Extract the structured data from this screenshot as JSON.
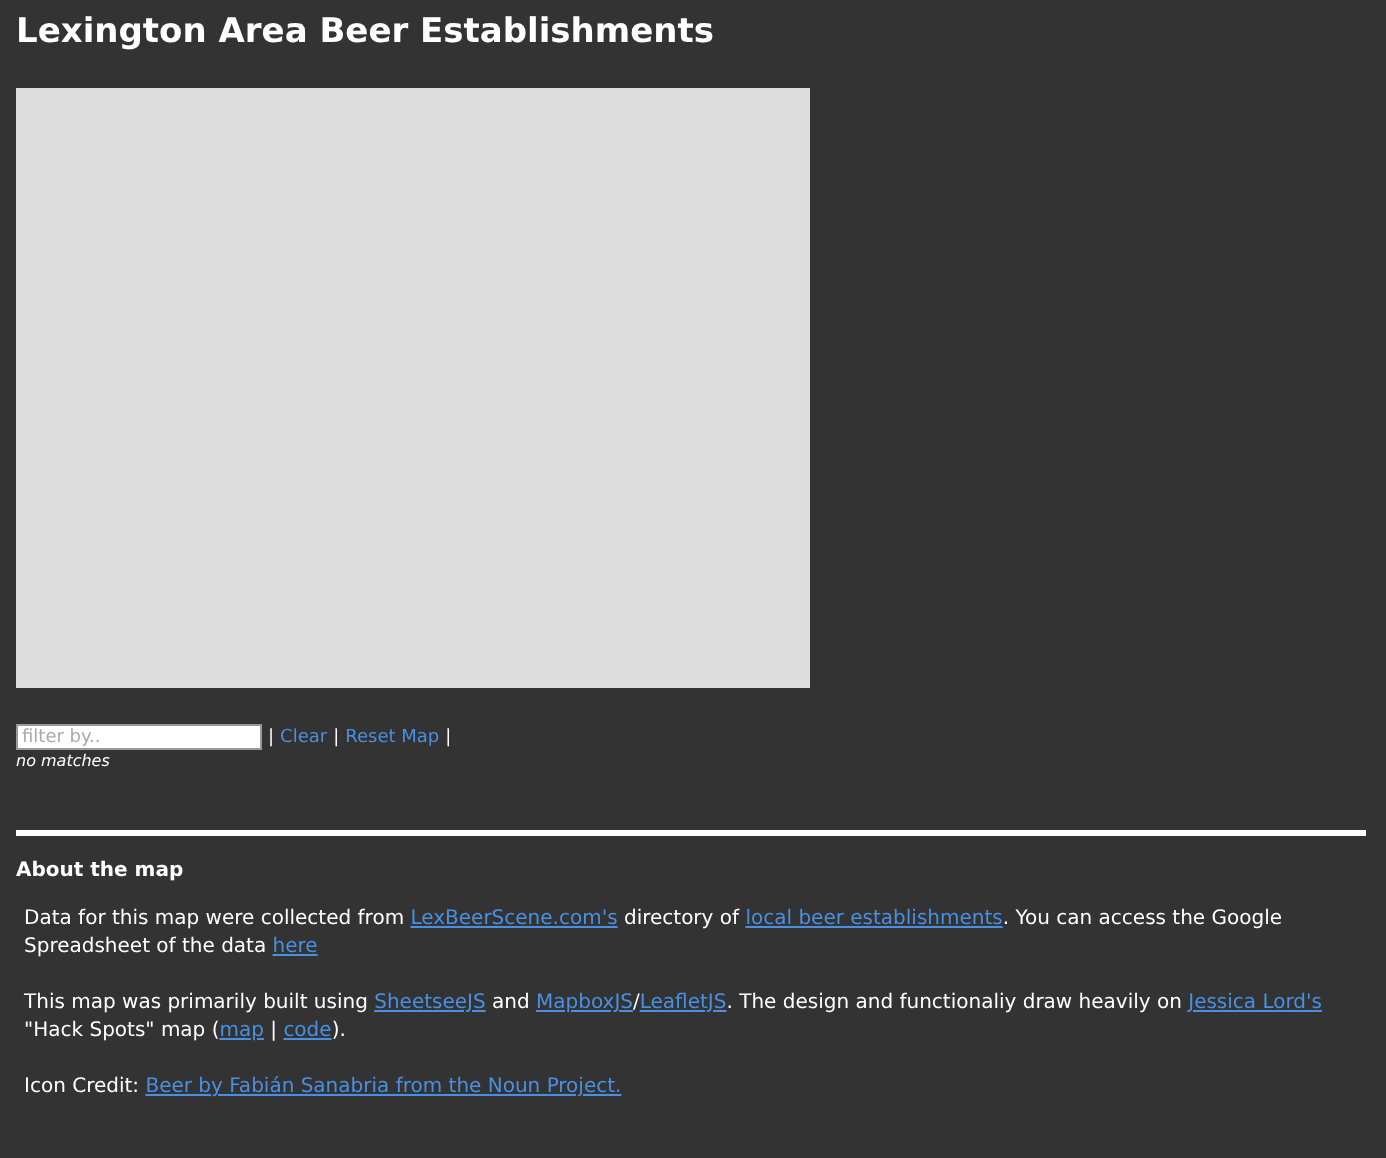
{
  "title": "Lexington Area Beer Establishments",
  "filter": {
    "placeholder": "filter by..",
    "items": [
      {
        "kind": "separator",
        "text": "|"
      },
      {
        "kind": "link",
        "text": "Clear"
      },
      {
        "kind": "separator",
        "text": "|"
      },
      {
        "kind": "link",
        "text": "Reset Map"
      },
      {
        "kind": "separator",
        "text": "|"
      }
    ],
    "status": "no matches"
  },
  "about": {
    "heading": "About the map",
    "paragraphs": [
      [
        {
          "kind": "text",
          "text": "Data for this map were collected from "
        },
        {
          "kind": "link",
          "text": "LexBeerScene.com's"
        },
        {
          "kind": "text",
          "text": " directory of "
        },
        {
          "kind": "link",
          "text": "local beer establishments"
        },
        {
          "kind": "text",
          "text": ". You can access the Google Spreadsheet of the data "
        },
        {
          "kind": "link",
          "text": "here"
        }
      ],
      [
        {
          "kind": "text",
          "text": "This map was primarily built using "
        },
        {
          "kind": "link",
          "text": "SheetseeJS"
        },
        {
          "kind": "text",
          "text": " and "
        },
        {
          "kind": "link",
          "text": "MapboxJS"
        },
        {
          "kind": "text",
          "text": "/"
        },
        {
          "kind": "link",
          "text": "LeafletJS"
        },
        {
          "kind": "text",
          "text": ". The design and functionaliy draw heavily on "
        },
        {
          "kind": "link",
          "text": "Jessica Lord's"
        },
        {
          "kind": "text",
          "text": " \"Hack Spots\" map ("
        },
        {
          "kind": "link",
          "text": "map"
        },
        {
          "kind": "text",
          "text": " | "
        },
        {
          "kind": "link",
          "text": "code"
        },
        {
          "kind": "text",
          "text": ")."
        }
      ],
      [
        {
          "kind": "text",
          "text": "Icon Credit: "
        },
        {
          "kind": "link",
          "text": "Beer by Fabián Sanabria from the Noun Project."
        }
      ]
    ]
  }
}
